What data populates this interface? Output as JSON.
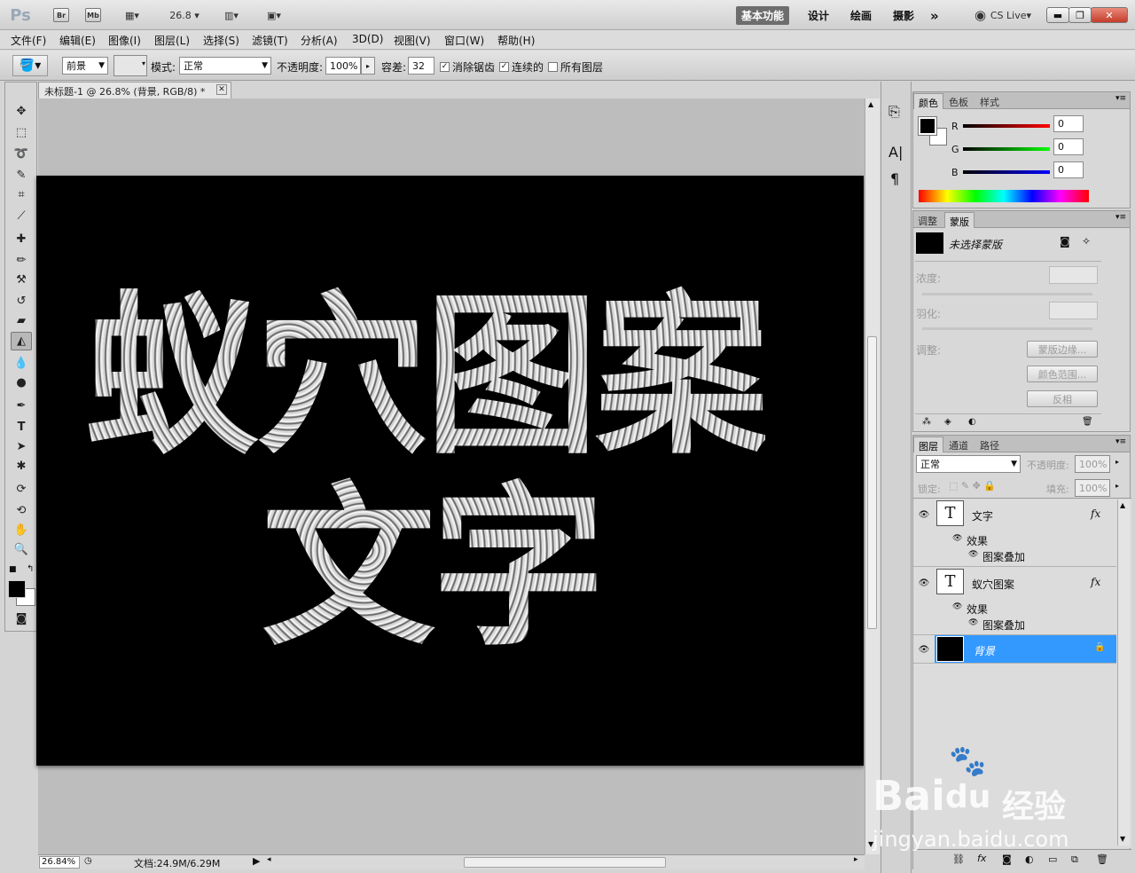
{
  "topbar": {
    "ps_logo": "Ps",
    "br": "Br",
    "mb": "Mb",
    "zoom": "26.8",
    "workspaces": [
      "基本功能",
      "设计",
      "绘画",
      "摄影"
    ],
    "more": "»",
    "cslive": "CS Live",
    "win_min": "▬",
    "win_max": "❐",
    "win_close": "✕"
  },
  "menu": [
    "文件(F)",
    "编辑(E)",
    "图像(I)",
    "图层(L)",
    "选择(S)",
    "滤镜(T)",
    "分析(A)",
    "3D(D)",
    "视图(V)",
    "窗口(W)",
    "帮助(H)"
  ],
  "options": {
    "fill_source": "前景",
    "mode_label": "模式:",
    "mode": "正常",
    "opacity_label": "不透明度:",
    "opacity": "100%",
    "tolerance_label": "容差:",
    "tolerance": "32",
    "antialias": "消除锯齿",
    "contiguous": "连续的",
    "all_layers": "所有图层",
    "antialias_checked": true,
    "contiguous_checked": true,
    "all_layers_checked": false
  },
  "document": {
    "tab_title": "未标题-1 @ 26.8% (背景, RGB/8) *",
    "canvas_line1": "蚁穴图案",
    "canvas_line2": "文字"
  },
  "status": {
    "zoom": "26.84%",
    "doc_info": "文档:24.9M/6.29M"
  },
  "color_panel": {
    "tabs": [
      "颜色",
      "色板",
      "样式"
    ],
    "r_label": "R",
    "g_label": "G",
    "b_label": "B",
    "r": "0",
    "g": "0",
    "b": "0",
    "foreground": "#000000",
    "background": "#ffffff"
  },
  "masks_panel": {
    "tabs": [
      "调整",
      "蒙版"
    ],
    "status": "未选择蒙版",
    "density_label": "浓度:",
    "feather_label": "羽化:",
    "refine_label": "调整:",
    "btn_edge": "蒙版边缘...",
    "btn_range": "颜色范围...",
    "btn_invert": "反相"
  },
  "layers_panel": {
    "tabs": [
      "图层",
      "通道",
      "路径"
    ],
    "blend": "正常",
    "opacity_label": "不透明度:",
    "opacity": "100%",
    "lock_label": "锁定:",
    "fill_label": "填充:",
    "fill": "100%",
    "layers": [
      {
        "name": "文字",
        "effects": "效果",
        "effect": "图案叠加",
        "fx": "fx"
      },
      {
        "name": "蚁穴图案",
        "effects": "效果",
        "effect": "图案叠加",
        "fx": "fx"
      },
      {
        "name": "背景"
      }
    ]
  },
  "watermark": {
    "brand": "Bai",
    "brand2": "du",
    "cn": "经验",
    "url": "jingyan.baidu.com"
  },
  "colors": {
    "selection": "#3399ff",
    "canvas": "#000000"
  }
}
